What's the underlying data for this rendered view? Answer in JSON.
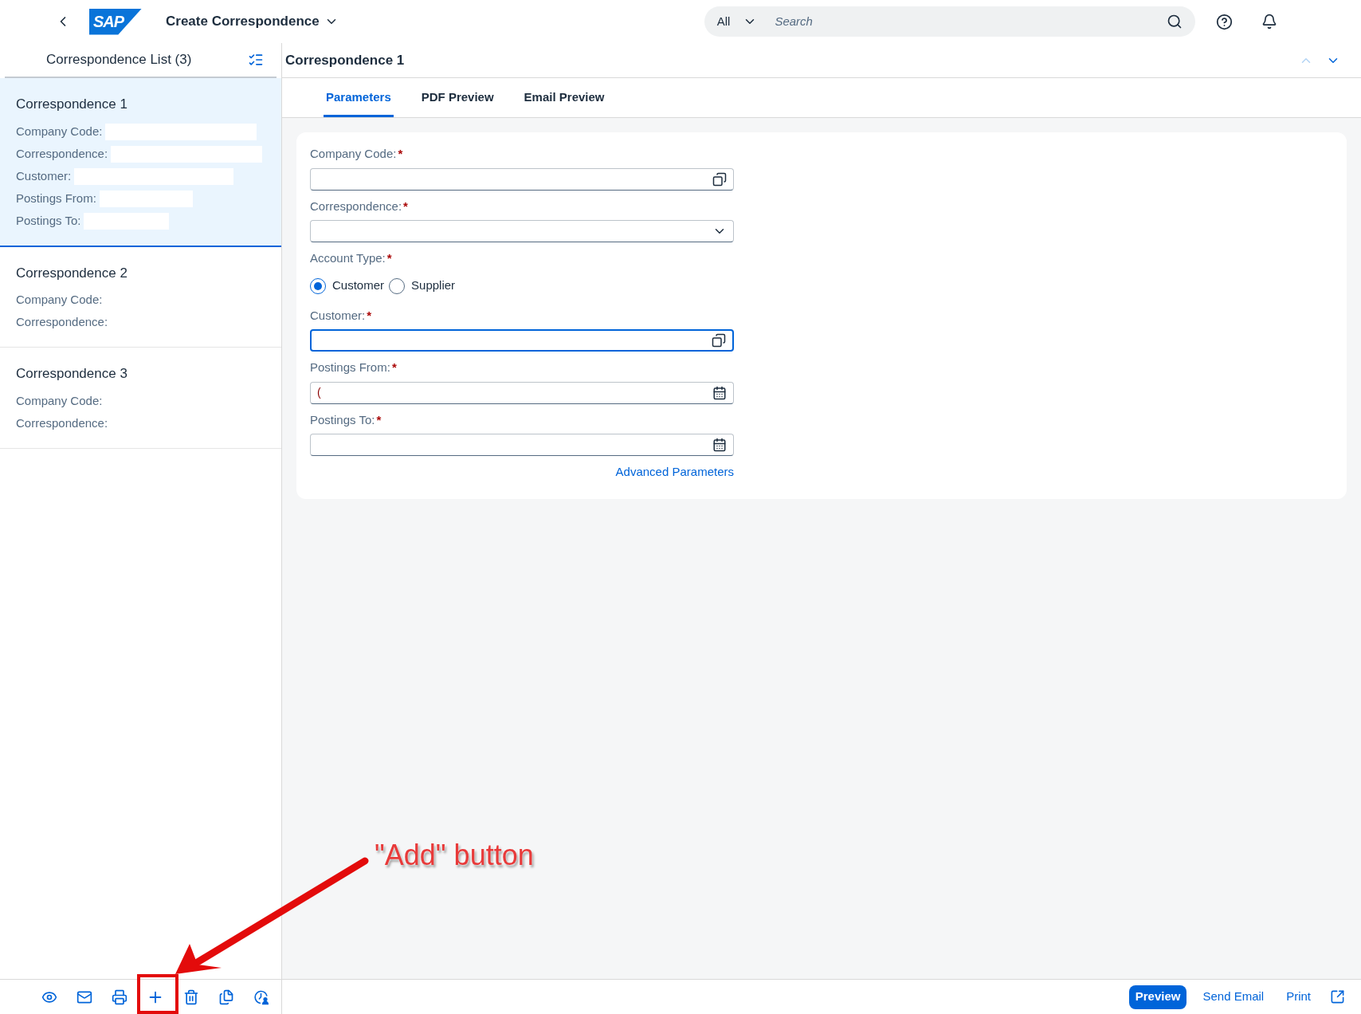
{
  "header": {
    "logo": "SAP",
    "title": "Create Correspondence",
    "search": {
      "scope": "All",
      "placeholder": "Search"
    }
  },
  "list": {
    "title": "Correspondence List (3)",
    "items": [
      {
        "title": "Correspondence 1",
        "selected": true,
        "fields": [
          {
            "label": "Company Code:",
            "redacted": true
          },
          {
            "label": "Correspondence:",
            "redacted": true
          },
          {
            "label": "Customer:",
            "redacted": true
          },
          {
            "label": "Postings From:",
            "redacted": true
          },
          {
            "label": "Postings To:",
            "redacted": true
          }
        ]
      },
      {
        "title": "Correspondence 2",
        "selected": false,
        "fields": [
          {
            "label": "Company Code:"
          },
          {
            "label": "Correspondence:"
          }
        ]
      },
      {
        "title": "Correspondence 3",
        "selected": false,
        "fields": [
          {
            "label": "Company Code:"
          },
          {
            "label": "Correspondence:"
          }
        ]
      }
    ]
  },
  "detail": {
    "title": "Correspondence 1",
    "tabs": [
      {
        "label": "Parameters",
        "selected": true
      },
      {
        "label": "PDF Preview",
        "selected": false
      },
      {
        "label": "Email Preview",
        "selected": false
      }
    ],
    "form": {
      "fields": [
        {
          "kind": "valuehelp",
          "label": "Company Code:",
          "required_mark": "*",
          "focused": false
        },
        {
          "kind": "select",
          "label": "Correspondence:",
          "required_mark": "*",
          "focused": false
        },
        {
          "kind": "radio",
          "label": "Account Type:",
          "required_mark": "*",
          "options": [
            {
              "label": "Customer",
              "selected": true
            },
            {
              "label": "Supplier",
              "selected": false
            }
          ]
        },
        {
          "kind": "valuehelp",
          "label": "Customer:",
          "required_mark": "*",
          "focused": true
        },
        {
          "kind": "date",
          "label": "Postings From:",
          "required_mark": "*",
          "focused": false,
          "value": "("
        },
        {
          "kind": "date",
          "label": "Postings To:",
          "required_mark": "*",
          "focused": false
        }
      ],
      "link": "Advanced Parameters"
    }
  },
  "footer": {
    "actions": [
      {
        "label": "Preview",
        "emphasized": true
      },
      {
        "label": "Send Email",
        "emphasized": false
      },
      {
        "label": "Print",
        "emphasized": false
      }
    ]
  },
  "annotation": {
    "label": "\"Add\" button"
  }
}
